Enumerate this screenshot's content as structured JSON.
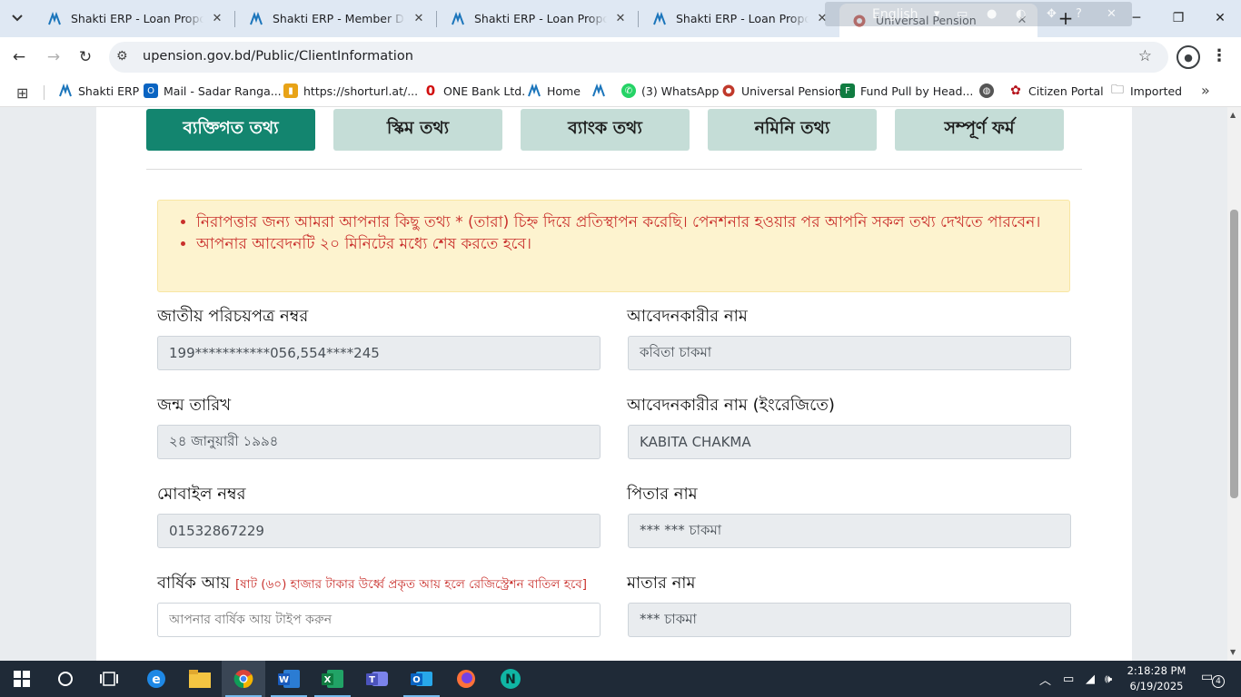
{
  "browser": {
    "tabs": [
      {
        "title": "Shakti ERP - Loan Proposal Li",
        "favicon": "shakti-icon"
      },
      {
        "title": "Shakti ERP - Member Details",
        "favicon": "shakti-icon"
      },
      {
        "title": "Shakti ERP - Loan Proposal Di",
        "favicon": "shakti-icon"
      },
      {
        "title": "Shakti ERP - Loan Proposal Di",
        "favicon": "shakti-icon"
      },
      {
        "title": "Universal Pension",
        "favicon": "pension-icon",
        "active": true
      }
    ],
    "overlay_text": "English",
    "url": "upension.gov.bd/Public/ClientInformation"
  },
  "bookmarks": [
    {
      "label": "Shakti ERP",
      "icon": "shakti-icon"
    },
    {
      "label": "Mail - Sadar Ranga...",
      "icon": "outlook-icon"
    },
    {
      "label": "https://shorturl.at/...",
      "icon": "bar-chart-icon"
    },
    {
      "label": "ONE Bank Ltd.",
      "icon": "one-bank-icon"
    },
    {
      "label": "Home",
      "icon": "shakti-icon"
    },
    {
      "label": "",
      "icon": "shakti-icon"
    },
    {
      "label": "(3) WhatsApp",
      "icon": "whatsapp-icon"
    },
    {
      "label": "Universal Pension",
      "icon": "pension-icon"
    },
    {
      "label": "Fund Pull by Head...",
      "icon": "forms-icon"
    },
    {
      "label": "",
      "icon": "globe-icon"
    },
    {
      "label": "Citizen Portal",
      "icon": "citizen-icon"
    },
    {
      "label": "Imported",
      "icon": "folder-icon"
    }
  ],
  "steps": [
    {
      "label": "ব্যক্তিগত তথ্য",
      "active": true
    },
    {
      "label": "স্কিম তথ্য"
    },
    {
      "label": "ব্যাংক তথ্য"
    },
    {
      "label": "নমিনি তথ্য"
    },
    {
      "label": "সম্পূর্ণ ফর্ম"
    }
  ],
  "notice": {
    "items": [
      "নিরাপত্তার জন্য আমরা আপনার কিছু তথ্য * (তারা) চিহ্ন দিয়ে প্রতিস্থাপন করেছি। পেনশনার হওয়ার পর আপনি সকল তথ্য দেখতে পারবেন।",
      "আপনার আবেদনটি ২০ মিনিটের মধ্যে শেষ করতে হবে।"
    ]
  },
  "form": {
    "nid": {
      "label": "জাতীয় পরিচয়পত্র নম্বর",
      "value": "199***********056,554****245"
    },
    "applicant_name": {
      "label": "আবেদনকারীর নাম",
      "value": "কবিতা চাকমা"
    },
    "dob": {
      "label": "জন্ম তারিখ",
      "value": "২৪ জানুয়ারী ১৯৯৪"
    },
    "applicant_name_en": {
      "label": "আবেদনকারীর নাম (ইংরেজিতে)",
      "value": "KABITA CHAKMA"
    },
    "mobile": {
      "label": "মোবাইল নম্বর",
      "value": "01532867229"
    },
    "father_name": {
      "label": "পিতার নাম",
      "value": "*** *** চাকমা"
    },
    "annual_income": {
      "label": "বার্ষিক আয়",
      "note": "[ষাট (৬০) হাজার টাকার উর্ধ্বে প্রকৃত আয় হলে রেজিস্ট্রেশন বাতিল হবে]",
      "placeholder": "আপনার বার্ষিক আয় টাইপ করুন"
    },
    "mother_name": {
      "label": "মাতার নাম",
      "value": "*** চাকমা"
    }
  },
  "taskbar": {
    "apps": [
      "windows-start-icon",
      "search-circle-icon",
      "task-view-icon",
      "edge-icon",
      "file-explorer-icon",
      "chrome-icon",
      "word-icon",
      "excel-icon",
      "teams-icon",
      "outlook-icon",
      "firefox-icon",
      "n-app-icon"
    ],
    "time": "2:18:28 PM",
    "date": "6/19/2025",
    "notification_count": "4"
  },
  "colors": {
    "active_step": "#13856f",
    "inactive_step": "#c5ddd7",
    "notice_bg": "#fdf3cf",
    "notice_text": "#c9302c"
  }
}
